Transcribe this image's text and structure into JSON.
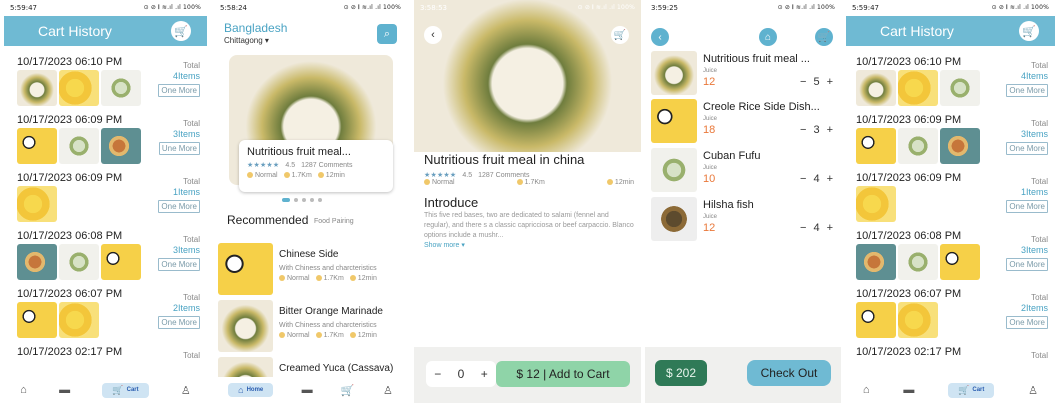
{
  "screens": {
    "cart_history_left": {
      "status": {
        "time": "5:59:47",
        "right": "⊙ ⊘ 𝄃 ≋.ıl .ıl 100%"
      },
      "title": "Cart History",
      "rows": [
        {
          "date": "10/17/2023 06:10 PM",
          "total_label": "Total",
          "count": "4Items",
          "more": "One More"
        },
        {
          "date": "10/17/2023 06:09 PM",
          "total_label": "Total",
          "count": "3Items",
          "more": "Une More"
        },
        {
          "date": "10/17/2023 06:09 PM",
          "total_label": "Total",
          "count": "1Items",
          "more": "One More"
        },
        {
          "date": "10/17/2023 06:08 PM",
          "total_label": "Total",
          "count": "3Items",
          "more": "One More"
        },
        {
          "date": "10/17/2023 06:07 PM",
          "total_label": "Total",
          "count": "2Items",
          "more": "One More"
        },
        {
          "date": "10/17/2023 02:17 PM",
          "total_label": "Total",
          "count": "",
          "more": ""
        }
      ],
      "nav": {
        "active_label": "Cart"
      }
    },
    "home": {
      "status": {
        "time": "5:58:24",
        "right": "⊙ ⊘ 𝄃 ≋.ıl .ıl 100%"
      },
      "country": "Bangladesh",
      "city": "Chittagong ▾",
      "hero": {
        "title": "Nutritious fruit meal...",
        "rating": "4.5",
        "comments": "1287  Comments",
        "level": "Normal",
        "distance": "1.7Km",
        "time": "12min"
      },
      "recommended_title": "Recommended",
      "recommended_sub": "Food Pairing",
      "items": [
        {
          "title": "Chinese Side",
          "desc": "With Chiness  and charcteristics",
          "level": "Normal",
          "distance": "1.7Km",
          "time": "12min"
        },
        {
          "title": "Bitter Orange Marinade",
          "desc": "With Chiness  and charcteristics",
          "level": "Normal",
          "distance": "1.7Km",
          "time": "12min"
        },
        {
          "title": "Creamed Yuca (Cassava)",
          "desc": "",
          "level": "",
          "distance": "",
          "time": ""
        }
      ],
      "nav": {
        "active_label": "Home"
      }
    },
    "detail": {
      "status": {
        "time": "3:58:53",
        "right": "⊙ ⊘ 𝄃 ≋.ıl .ıl 100%"
      },
      "title": "Nutritious fruit meal in china",
      "rating": "4.5",
      "comments": "1287  Comments",
      "level": "Normal",
      "distance": "1.7Km",
      "time": "12min",
      "intro_title": "Introduce",
      "intro_text": "This five red bases, two are dedicated to salami (fennel and regular), and there s a classic capricciosa or beef carpaccio. Blanco options include a mushr...",
      "show_more": "Show more ▾",
      "qty": "0",
      "add_to_cart": "$ 12 | Add to Cart"
    },
    "cart": {
      "status": {
        "time": "3:59:25",
        "right": "⊙ ⊘ 𝄃 ≋.ıl .ıl 100%"
      },
      "items": [
        {
          "name": "Nutritious fruit meal ...",
          "category": "Juice",
          "price": "12",
          "qty": "5"
        },
        {
          "name": "Creole Rice Side Dish...",
          "category": "Juice",
          "price": "18",
          "qty": "3"
        },
        {
          "name": "Cuban Fufu",
          "category": "Juice",
          "price": "10",
          "qty": "4"
        },
        {
          "name": "Hilsha fish",
          "category": "Juice",
          "price": "12",
          "qty": "4"
        }
      ],
      "total": "$ 202",
      "checkout": "Check Out"
    },
    "cart_history_right": {
      "status": {
        "time": "5:59:47",
        "right": "⊙ ⊘ 𝄃 ≋.ıl .ıl 100%"
      },
      "title": "Cart History",
      "rows": [
        {
          "date": "10/17/2023 06:10 PM",
          "total_label": "Total",
          "count": "4Items",
          "more": "One More"
        },
        {
          "date": "10/17/2023 06:09 PM",
          "total_label": "Total",
          "count": "3Items",
          "more": "One More"
        },
        {
          "date": "10/17/2023 06:09 PM",
          "total_label": "Total",
          "count": "1Items",
          "more": "One More"
        },
        {
          "date": "10/17/2023 06:08 PM",
          "total_label": "Total",
          "count": "3Items",
          "more": "One More"
        },
        {
          "date": "10/17/2023 06:07 PM",
          "total_label": "Total",
          "count": "2Items",
          "more": "One More"
        },
        {
          "date": "10/17/2023 02:17 PM",
          "total_label": "Total",
          "count": "",
          "more": ""
        }
      ],
      "nav": {
        "active_label": "Cart"
      }
    }
  },
  "icons": {
    "cart": "🛒",
    "home": "⌂",
    "archive": "▬",
    "user": "♙",
    "search": "⌕",
    "back": "‹",
    "stars": "★★★★★"
  },
  "colors": {
    "header": "#6fbad3",
    "accent": "#4aa3c3",
    "price": "#e9783a",
    "add_to_cart": "#8fd4a8",
    "total_pill": "#2f7a57"
  }
}
